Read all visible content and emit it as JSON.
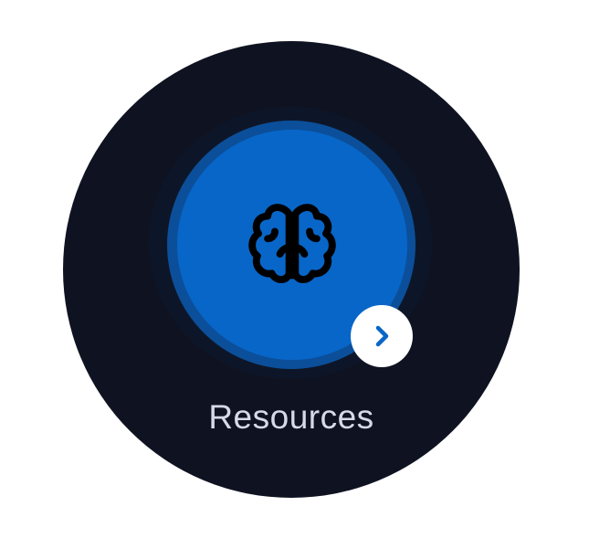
{
  "tile": {
    "label": "Resources",
    "icon": "brain-icon",
    "action_icon": "chevron-right-icon"
  },
  "colors": {
    "background": "#ffffff",
    "tile_background": "#0f1321",
    "accent": "#0866c8",
    "accent_ring": "#0b4f9a",
    "label_text": "#d5dbe6",
    "badge": "#ffffff",
    "chevron": "#0866c8"
  }
}
